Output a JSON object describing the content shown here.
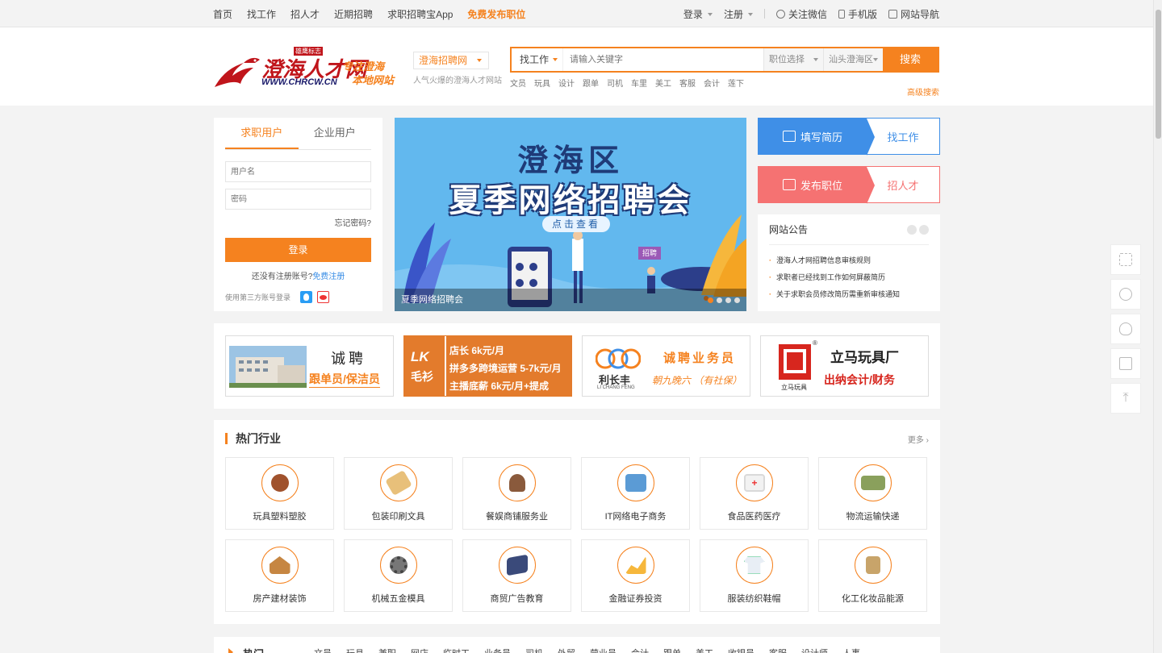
{
  "topnav": {
    "items": [
      "首页",
      "找工作",
      "招人才",
      "近期招聘",
      "求职招聘宝App",
      "免费发布职位"
    ],
    "login": "登录",
    "register": "注册",
    "wechat": "关注微信",
    "mobile": "手机版",
    "sitenav": "网站导航"
  },
  "header": {
    "logo_text": "澄海人才网",
    "logo_url_text": "WWW.CHRCW.CN",
    "logo_badge": "雄鹰标志",
    "logo_slogan_1": "专注澄海",
    "logo_slogan_2": "本地网站",
    "site_select": "澄海招聘网",
    "slogan": "人气火爆的澄海人才网站",
    "search_type": "找工作",
    "search_placeholder": "请输入关键字",
    "position_select": "职位选择",
    "area_select": "汕头澄海区",
    "search_button": "搜索",
    "advanced": "高级搜索",
    "hotwords": [
      "文员",
      "玩具",
      "设计",
      "跟单",
      "司机",
      "车里",
      "美工",
      "客服",
      "会计",
      "莲下"
    ]
  },
  "login": {
    "tab_seeker": "求职用户",
    "tab_company": "企业用户",
    "username_placeholder": "用户名",
    "password_placeholder": "密码",
    "forgot": "忘记密码?",
    "button": "登录",
    "no_account": "还没有注册账号?",
    "free_register": "免费注册",
    "third_party": "使用第三方账号登录"
  },
  "banner": {
    "title1": "澄海区",
    "title2": "夏季网络招聘会",
    "button": "点击查看",
    "badge": "招聘",
    "caption": "夏季网络招聘会"
  },
  "quick": {
    "resume": "填写简历",
    "find_job": "找工作",
    "post_job": "发布职位",
    "find_talent": "招人才"
  },
  "notice": {
    "title": "网站公告",
    "items": [
      "澄海人才网招聘信息审核规则",
      "求职者已经找到工作如何屏蔽简历",
      "关于求职会员修改简历需重新审核通知"
    ]
  },
  "ads": [
    {
      "title": "诚聘",
      "sub": "跟单员/保洁员"
    },
    {
      "logo": "LK",
      "logo2": "毛衫",
      "lines": [
        "店长   6k元/月",
        "拼多多跨境运营  5-7k元/月",
        "主播底薪   6k元/月+提成"
      ]
    },
    {
      "brand": "利长丰",
      "brand_en": "LI CHANG FENG",
      "title": "诚聘业务员",
      "sub": "朝九晚六 （有社保）"
    },
    {
      "brand": "立马玩具",
      "title": "立马玩具厂",
      "sub": "出纳会计/财务"
    }
  ],
  "industry": {
    "title": "热门行业",
    "more": "更多",
    "items": [
      "玩具塑料塑胶",
      "包装印刷文具",
      "餐娱商铺服务业",
      "IT网络电子商务",
      "食品医药医疗",
      "物流运输快递",
      "房产建材装饰",
      "机械五金模具",
      "商贸广告教育",
      "金融证券投资",
      "服装纺织鞋帽",
      "化工化妆品能源"
    ]
  },
  "hotbar": {
    "title": "热门",
    "keywords": [
      "文员",
      "玩具",
      "兼职",
      "网店",
      "临时工",
      "业务员",
      "司机",
      "外贸",
      "营业员",
      "会计",
      "跟单",
      "美工",
      "收银员",
      "客服",
      "设计师",
      "人事"
    ]
  },
  "colors": {
    "accent": "#f5821f",
    "blue": "#3f8fe7",
    "red": "#f57272"
  }
}
